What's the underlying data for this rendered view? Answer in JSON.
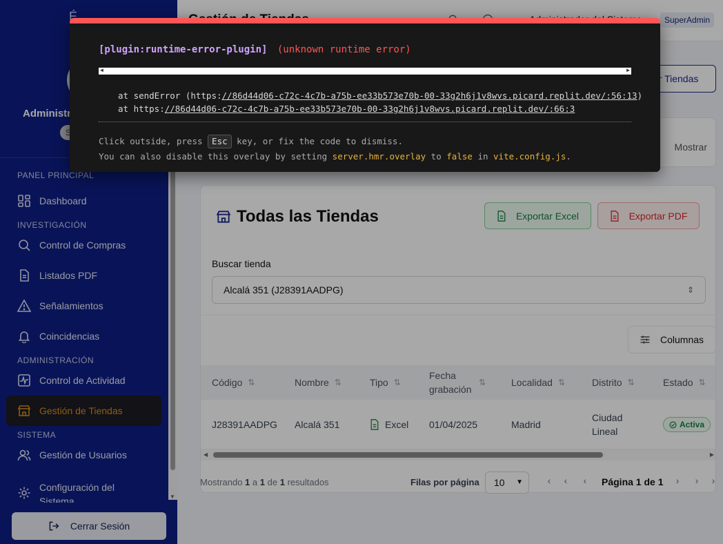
{
  "sidebar": {
    "user_name": "Administrador del Sistema",
    "user_name_visible": "Administr",
    "role_initial": "S",
    "sections": {
      "main": "PANEL PRINCIPAL",
      "research": "INVESTIGACIÓN",
      "admin": "ADMINISTRACIÓN",
      "system": "SISTEMA"
    },
    "items": [
      {
        "label": "Dashboard",
        "icon": "dashboard-icon"
      },
      {
        "label": "Control de Compras",
        "icon": "search-icon"
      },
      {
        "label": "Listados PDF",
        "icon": "document-icon"
      },
      {
        "label": "Señalamientos",
        "icon": "warning-icon"
      },
      {
        "label": "Coincidencias",
        "icon": "bell-icon"
      },
      {
        "label": "Control de Actividad",
        "icon": "activity-icon"
      },
      {
        "label": "Gestión de Tiendas",
        "icon": "store-icon"
      },
      {
        "label": "Gestión de Usuarios",
        "icon": "users-icon"
      },
      {
        "label": "Configuración del Sistema",
        "icon": "settings-icon"
      }
    ],
    "active_item": "Gestión de Tiendas",
    "logout_label": "Cerrar Sesión"
  },
  "header": {
    "title": "Gestión de Tiendas",
    "user_label": "Administrador del Sistema",
    "role_badge": "SuperAdmin"
  },
  "actions": {
    "manage_button": "Gestionar Tiendas",
    "manage_button_visible": "ar Tiendas"
  },
  "filters": {
    "show_label": "Mostrar"
  },
  "stores_card": {
    "title": "Todas las Tiendas",
    "export_excel": "Exportar Excel",
    "export_pdf": "Exportar PDF",
    "search_label": "Buscar tienda",
    "search_value": "Alcalá 351 (J28391AADPG)",
    "columns_button": "Columnas",
    "columns": [
      "Código",
      "Nombre",
      "Tipo",
      "Fecha grabación",
      "Localidad",
      "Distrito",
      "Estado"
    ],
    "rows": [
      {
        "codigo": "J28391AADPG",
        "nombre": "Alcalá 351",
        "tipo": "Excel",
        "fecha": "01/04/2025",
        "localidad": "Madrid",
        "distrito": "Ciudad Lineal",
        "estado": "Activa"
      }
    ]
  },
  "pagination": {
    "showing_prefix": "Mostrando",
    "from": "1",
    "to": "1",
    "total": "1",
    "a": "a",
    "de": "de",
    "results": "resultados",
    "rows_per_page_label": "Filas por página",
    "rows_per_page": "10",
    "page_prefix": "Página",
    "page": "1",
    "page_of": "de",
    "page_total": "1"
  },
  "error_overlay": {
    "plugin": "[plugin:runtime-error-plugin]",
    "message": "(unknown runtime error)",
    "stack_line1_prefix": "at sendError (https:",
    "stack_line1_url": "//86d44d06-c72c-4c7b-a75b-ee33b573e70b-00-33g2h6j1v8wvs.picard.replit.dev/:56:13",
    "stack_line1_suffix": ")",
    "stack_line2_prefix": "at https:",
    "stack_line2_url": "//86d44d06-c72c-4c7b-a75b-ee33b573e70b-00-33g2h6j1v8wvs.picard.replit.dev/:66:3",
    "tip1_a": "Click outside, press",
    "tip1_key": "Esc",
    "tip1_b": "key, or fix the code to dismiss.",
    "tip2_a": "You can also disable this overlay by setting",
    "tip2_setting": "server.hmr.overlay",
    "tip2_b": "to",
    "tip2_value": "false",
    "tip2_c": "in",
    "tip2_file": "vite.config.js",
    "tip2_d": "."
  },
  "colors": {
    "sidebar_bg": "#0e1f86",
    "active_item": "#d98d1f",
    "error_accent": "#ff5555",
    "success": "#15803d",
    "danger": "#dc2626"
  }
}
